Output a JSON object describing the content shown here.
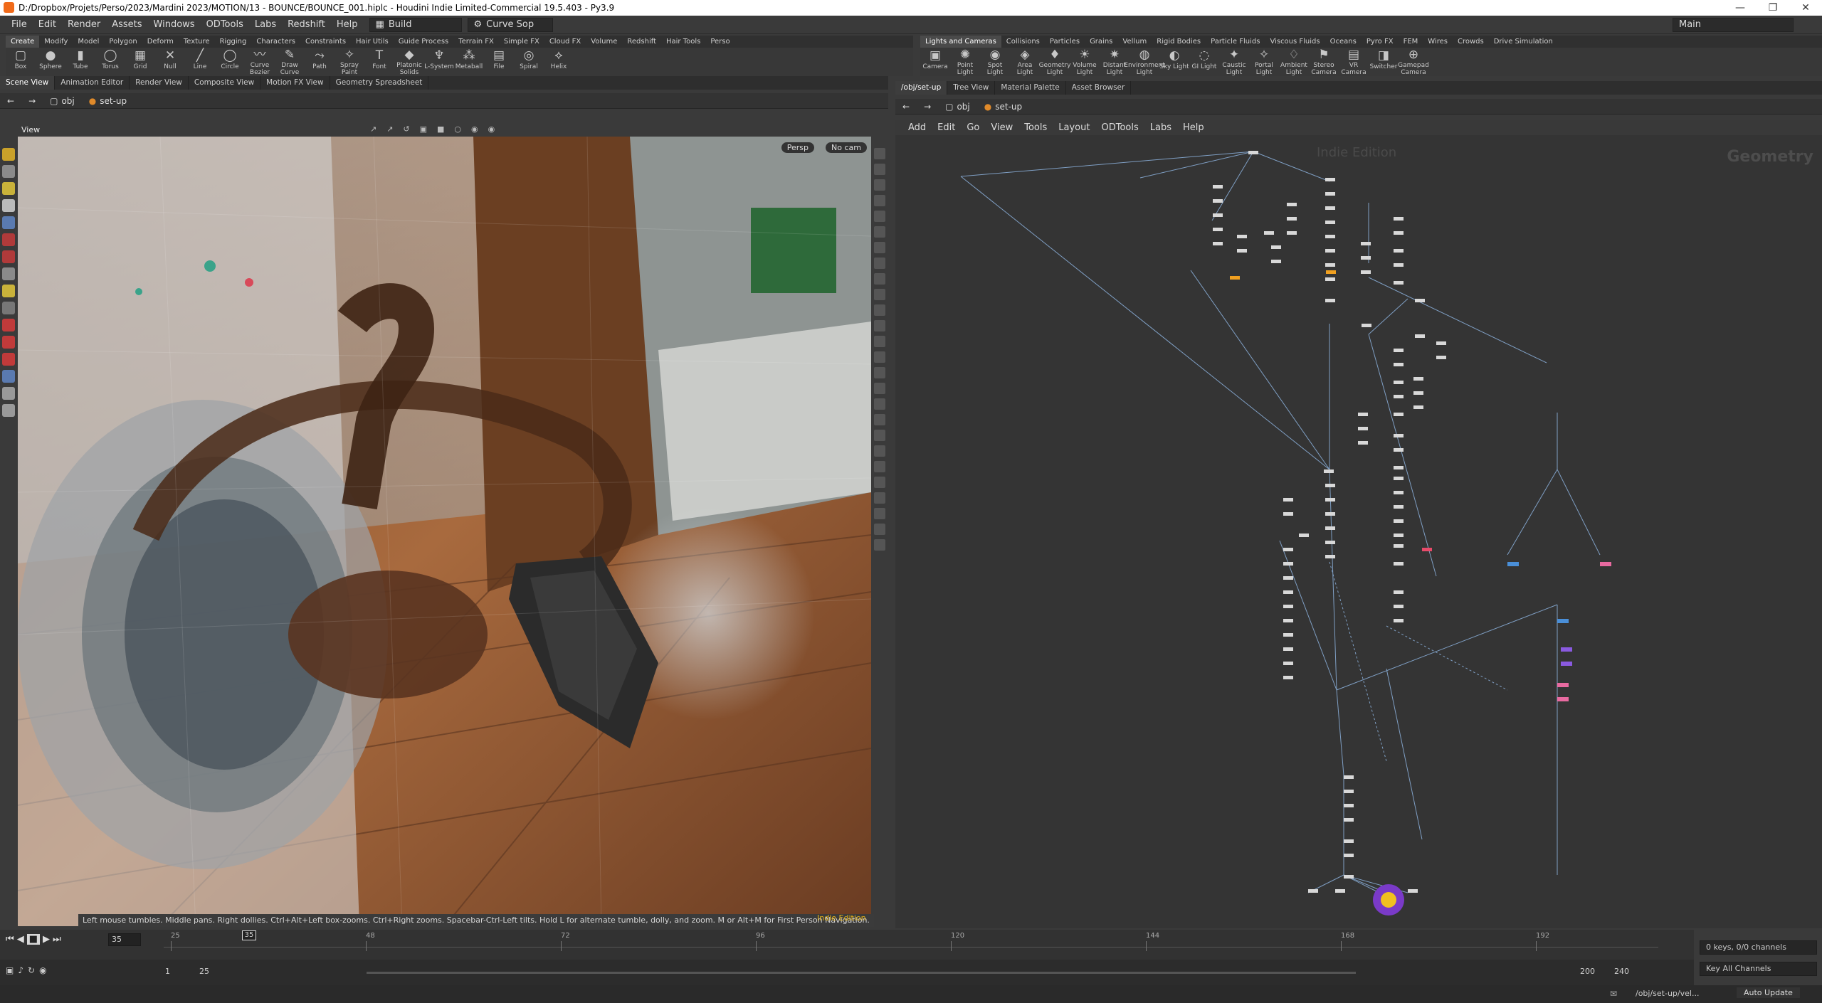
{
  "window": {
    "title": "D:/Dropbox/Projets/Perso/2023/Mardini 2023/MOTION/13 - BOUNCE/BOUNCE_001.hiplc - Houdini Indie Limited-Commercial 19.5.403 - Py3.9"
  },
  "menu": [
    "File",
    "Edit",
    "Render",
    "Assets",
    "Windows",
    "ODTools",
    "Labs",
    "Redshift",
    "Help"
  ],
  "build_combo": "Build",
  "curve_combo": "Curve Sop",
  "desktop_combo": "Main",
  "left_shelf": {
    "tabs": [
      "Create",
      "Modify",
      "Model",
      "Polygon",
      "Deform",
      "Texture",
      "Rigging",
      "Characters",
      "Constraints",
      "Hair Utils",
      "Guide Process",
      "Terrain FX",
      "Simple FX",
      "Cloud FX",
      "Volume",
      "Redshift",
      "Hair Tools",
      "Perso"
    ],
    "tools": [
      "Box",
      "Sphere",
      "Tube",
      "Torus",
      "Grid",
      "Null",
      "Line",
      "Circle",
      "Curve Bezier",
      "Draw Curve",
      "Path",
      "Spray Paint",
      "Font",
      "Platonic Solids",
      "L-System",
      "Metaball",
      "File",
      "Spiral",
      "Helix"
    ]
  },
  "right_shelf": {
    "tabs": [
      "Lights and Cameras",
      "Collisions",
      "Particles",
      "Grains",
      "Vellum",
      "Rigid Bodies",
      "Particle Fluids",
      "Viscous Fluids",
      "Oceans",
      "Pyro FX",
      "FEM",
      "Wires",
      "Crowds",
      "Drive Simulation"
    ],
    "tools": [
      "Camera",
      "Point Light",
      "Spot Light",
      "Area Light",
      "Geometry Light",
      "Volume Light",
      "Distant Light",
      "Environment Light",
      "Sky Light",
      "GI Light",
      "Caustic Light",
      "Portal Light",
      "Ambient Light",
      "Stereo Camera",
      "VR Camera",
      "Switcher",
      "Gamepad Camera"
    ]
  },
  "left_panel_tabs": [
    "Scene View",
    "Animation Editor",
    "Render View",
    "Composite View",
    "Motion FX View",
    "Geometry Spreadsheet"
  ],
  "right_panel_tabs": [
    "/obj/set-up",
    "Tree View",
    "Material Palette",
    "Asset Browser"
  ],
  "left_path": {
    "root": "obj",
    "node": "set-up"
  },
  "right_path": {
    "root": "obj",
    "node": "set-up"
  },
  "viewport": {
    "label": "View",
    "persp": "Persp",
    "cam": "No cam",
    "hint": "Left mouse tumbles. Middle pans. Right dollies. Ctrl+Alt+Left box-zooms. Ctrl+Right zooms. Spacebar-Ctrl-Left tilts. Hold L for alternate tumble, dolly, and zoom.     M or Alt+M for First Person Navigation.",
    "indie": "Indie Edition"
  },
  "network": {
    "menu": [
      "Add",
      "Edit",
      "Go",
      "View",
      "Tools",
      "Layout",
      "ODTools",
      "Labs",
      "Help"
    ],
    "watermark": "Indie Edition",
    "context": "Geometry"
  },
  "timeline": {
    "frame": "35",
    "marker": "35",
    "ticks": [
      "25",
      "48",
      "72",
      "96",
      "120",
      "144",
      "168",
      "192"
    ],
    "range_start": "1",
    "range_start2": "25",
    "range_end": "200",
    "range_end2": "240"
  },
  "keys": {
    "info": "0 keys, 0/0 channels",
    "mode": "Key All Channels"
  },
  "status": {
    "path": "/obj/set-up/vel...",
    "update": "Auto Update"
  },
  "colors": {
    "accent_orange": "#e4b21a",
    "node_blue": "#4a8fd8",
    "node_pink": "#e86aa0",
    "node_purple": "#8a5ae0"
  }
}
